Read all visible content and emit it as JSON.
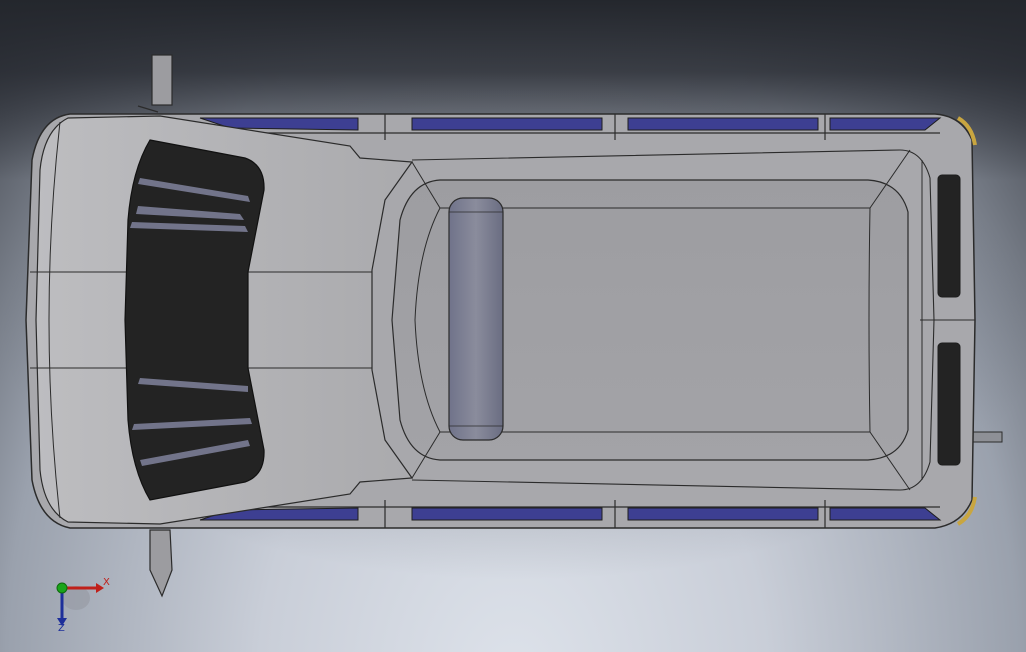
{
  "triad": {
    "x_label": "X",
    "z_label": "Z",
    "colors": {
      "x": "#c0201a",
      "y": "#1aa51a",
      "z": "#1d2f9a"
    }
  },
  "model": {
    "body_color": "#a9a9ad",
    "window_color": "#232323",
    "side_glass_color": "#3d3f92",
    "trim_color": "#c9a640",
    "antenna_color": "#7d7f8f"
  }
}
